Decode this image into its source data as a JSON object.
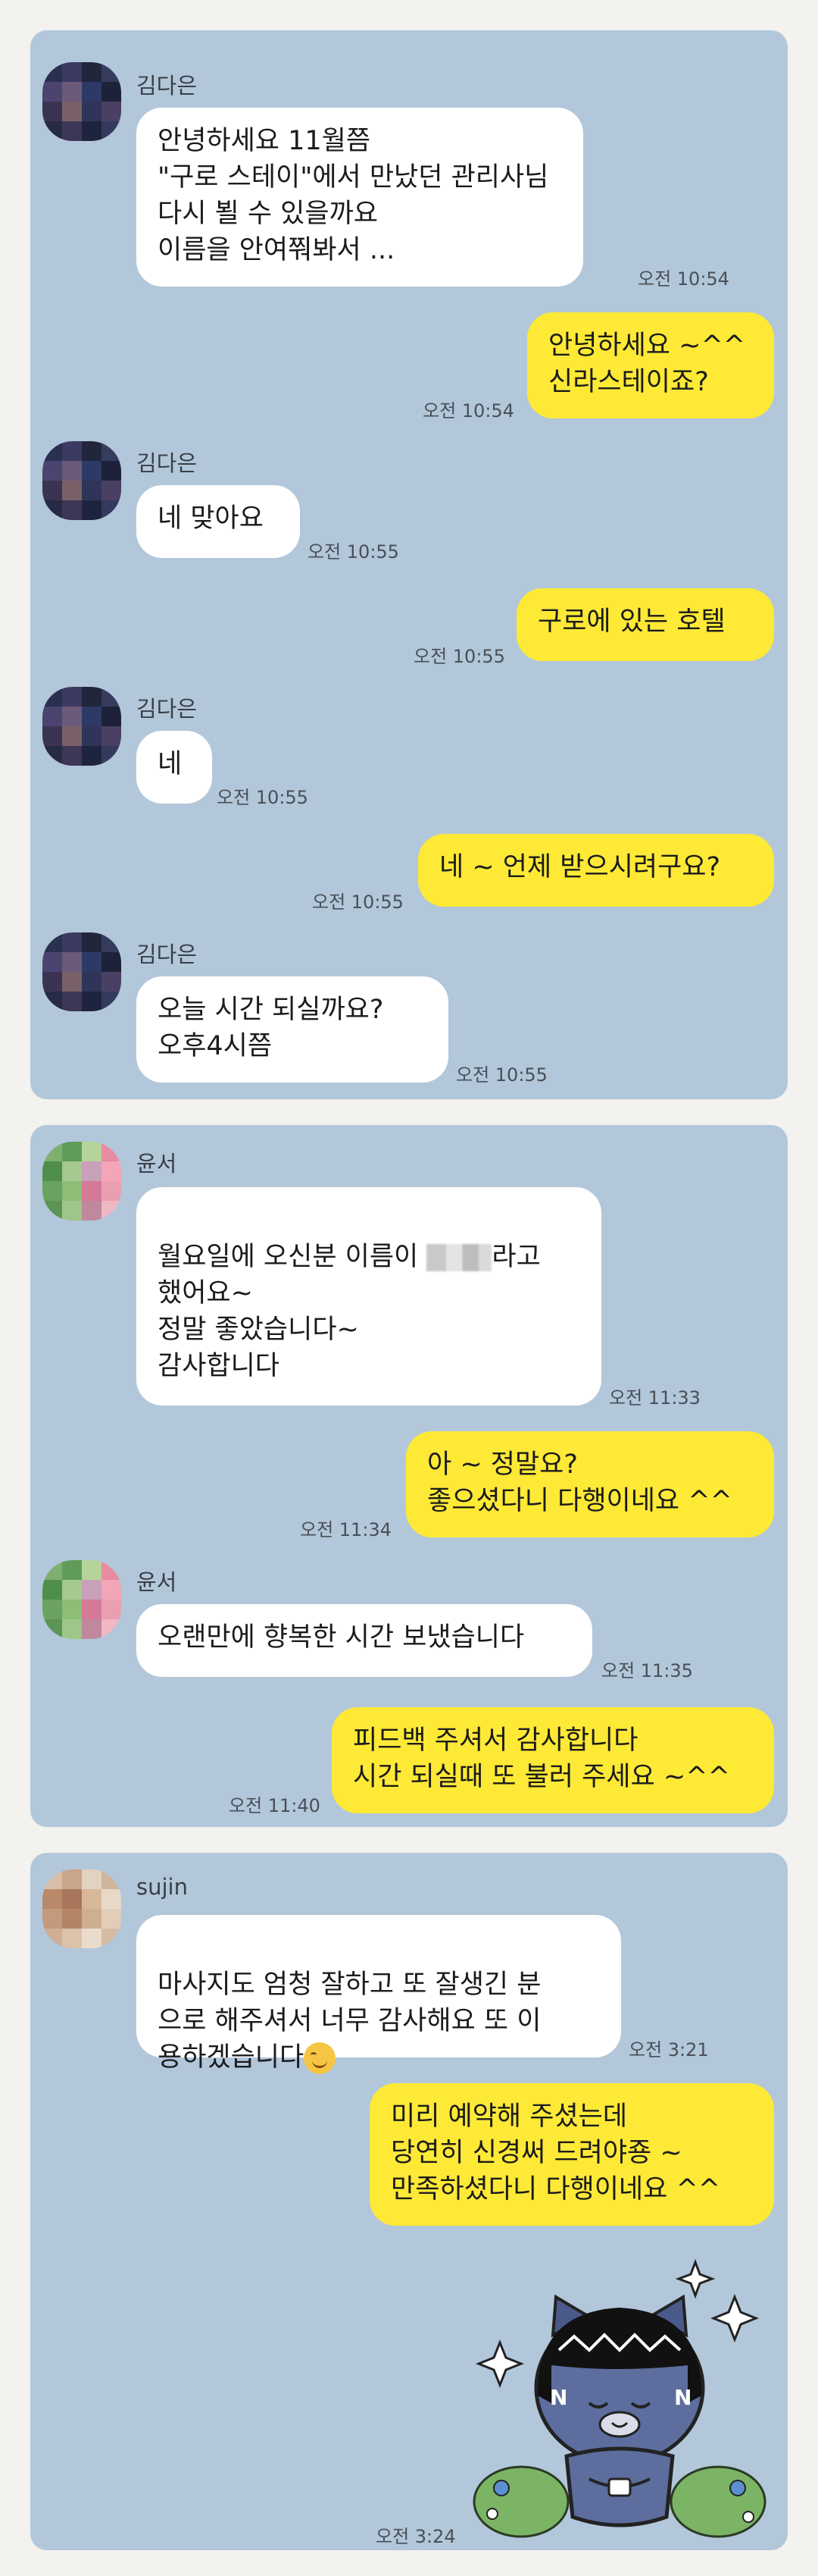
{
  "chats": [
    {
      "sender": "김다은",
      "messages": [
        {
          "dir": "in",
          "text": "안녕하세요 11월쯤\n\"구로 스테이\"에서 만났던 관리사님\n다시 뵐 수 있을까요\n이름을 안여쭤봐서 ...",
          "time": "오전 10:54"
        },
        {
          "dir": "out",
          "text": "안녕하세요 ~^^\n신라스테이죠?",
          "time": "오전 10:54"
        },
        {
          "dir": "in",
          "text": "네 맞아요",
          "time": "오전 10:55"
        },
        {
          "dir": "out",
          "text": "구로에 있는 호텔",
          "time": "오전 10:55"
        },
        {
          "dir": "in",
          "text": "네",
          "time": "오전 10:55"
        },
        {
          "dir": "out",
          "text": "네 ~ 언제 받으시려구요?",
          "time": "오전 10:55"
        },
        {
          "dir": "in",
          "text": "오늘  시간 되실까요?\n오후4시쯤",
          "time": "오전 10:55"
        }
      ]
    },
    {
      "sender": "윤서",
      "messages": [
        {
          "dir": "in",
          "text_before": "월요일에 오신분 이름이 ",
          "text_after": "라고",
          "text_rest": "했어요~\n정말 좋았습니다~\n감사합니다",
          "time": "오전 11:33"
        },
        {
          "dir": "out",
          "text": "아 ~ 정말요?\n좋으셨다니 다행이네요 ^^",
          "time": "오전 11:34"
        },
        {
          "dir": "in",
          "text": "오랜만에 향복한 시간 보냈습니다",
          "time": "오전 11:35"
        },
        {
          "dir": "out",
          "text": "피드백 주셔서 감사합니다\n시간 되실때 또 불러 주세요 ~^^",
          "time": "오전 11:40"
        }
      ]
    },
    {
      "sender": "sujin",
      "messages": [
        {
          "dir": "in",
          "text": "마사지도 엄청 잘하고 또 잘생긴 분\n으로 해주셔서 너무 감사해요 또 이\n용하겠습니다",
          "emoji": "smiling-face",
          "time": "오전 3:21"
        },
        {
          "dir": "out",
          "text": "미리 예약해 주셨는데\n당연히 신경써 드려야죵 ~\n만족하셨다니 다행이네요 ^^",
          "time": ""
        },
        {
          "dir": "out",
          "sticker": "kakao-ryan-sticker",
          "time": "오전 3:24"
        }
      ]
    }
  ],
  "colors": {
    "panel": "#b2c7da",
    "incoming": "#ffffff",
    "outgoing": "#fde936",
    "background": "#f3f2ee"
  }
}
